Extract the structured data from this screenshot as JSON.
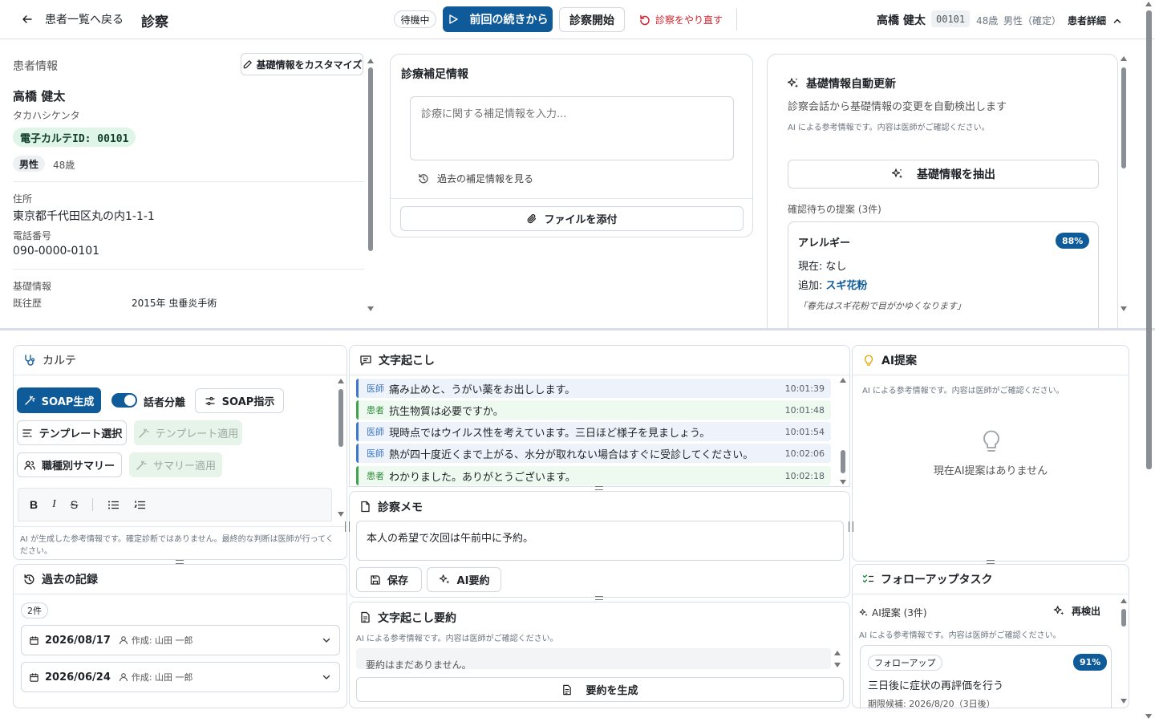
{
  "header": {
    "back_label": "患者一覧へ戻る",
    "page_title": "診察",
    "status_badge": "待機中",
    "resume_button": "前回の続きから",
    "start_button": "診察開始",
    "redo_button": "診察をやり直す",
    "patient_name": "高橋 健太",
    "patient_id": "00101",
    "patient_age": "48歳",
    "patient_sex": "男性（確定）",
    "details_label": "患者詳細"
  },
  "patient_info": {
    "section_title": "患者情報",
    "customize_button": "基礎情報をカスタマイズ",
    "name": "高橋 健太",
    "kana": "タカハシケンタ",
    "ehr_id": "電子カルテID: 00101",
    "sex_badge": "男性",
    "age": "48歳",
    "address_label": "住所",
    "address": "東京都千代田区丸の内1-1-1",
    "phone_label": "電話番号",
    "phone": "090-0000-0101",
    "basic_label": "基礎情報",
    "history_label": "既往歴",
    "history_value": "2015年 虫垂炎手術"
  },
  "supplement": {
    "title": "診療補足情報",
    "placeholder": "診療に関する補足情報を入力...",
    "past_link": "過去の補足情報を見る",
    "attach_button": "ファイルを添付"
  },
  "auto_update": {
    "title": "基礎情報自動更新",
    "description": "診察会話から基礎情報の変更を自動検出します",
    "note": "AI による参考情報です。内容は医師がご確認ください。",
    "extract_button": "基礎情報を抽出",
    "pending_label": "確認待ちの提案 (3件)",
    "proposal": {
      "category": "アレルギー",
      "confidence": "88%",
      "current_label": "現在:",
      "current_value": "なし",
      "add_label": "追加:",
      "add_value": "スギ花粉",
      "quote": "「春先はスギ花粉で目がかゆくなります」"
    }
  },
  "karte": {
    "title": "カルテ",
    "soap_generate": "SOAP生成",
    "speaker_toggle": "話者分離",
    "speaker_toggle_on": true,
    "soap_instruction": "SOAP指示",
    "template_select": "テンプレート選択",
    "template_apply": "テンプレート適用",
    "role_summary": "職種別サマリー",
    "summary_apply": "サマリー適用",
    "disclaimer": "AI が生成した参考情報です。確定診断ではありません。最終的な判断は医師が行ってください。"
  },
  "transcript": {
    "title": "文字起こし",
    "rows": [
      {
        "speaker": "医師",
        "role": "doc",
        "text": "痛み止めと、うがい薬をお出しします。",
        "time": "10:01:39"
      },
      {
        "speaker": "患者",
        "role": "pat",
        "text": "抗生物質は必要ですか。",
        "time": "10:01:48"
      },
      {
        "speaker": "医師",
        "role": "doc",
        "text": "現時点ではウイルス性を考えています。三日ほど様子を見ましょう。",
        "time": "10:01:54"
      },
      {
        "speaker": "医師",
        "role": "doc",
        "text": "熱が四十度近くまで上がる、水分が取れない場合はすぐに受診してください。",
        "time": "10:02:06"
      },
      {
        "speaker": "患者",
        "role": "pat",
        "text": "わかりました。ありがとうございます。",
        "time": "10:02:18"
      }
    ]
  },
  "ai_suggest": {
    "title": "AI提案",
    "note": "AI による参考情報です。内容は医師がご確認ください。",
    "empty": "現在AI提案はありません"
  },
  "memo": {
    "title": "診察メモ",
    "content": "本人の希望で次回は午前中に予約。",
    "save_button": "保存",
    "ai_summary_button": "AI要約"
  },
  "history": {
    "title": "過去の記録",
    "count": "2件",
    "records": [
      {
        "date": "2026/08/17",
        "author": "作成: 山田 一郎"
      },
      {
        "date": "2026/06/24",
        "author": "作成: 山田 一郎"
      }
    ]
  },
  "summary": {
    "title": "文字起こし要約",
    "note": "AI による参考情報です。内容は医師がご確認ください。",
    "empty": "要約はまだありません。",
    "generate_button": "要約を生成"
  },
  "followup": {
    "title": "フォローアップタスク",
    "ai_label": "AI提案 (3件)",
    "redetect": "再検出",
    "note": "AI による参考情報です。内容は医師がご確認ください。",
    "task": {
      "tag": "フォローアップ",
      "confidence": "91%",
      "text": "三日後に症状の再評価を行う",
      "due": "期限候補: 2026/8/20（3日後）"
    }
  },
  "colors": {
    "primary": "#0f5b9a",
    "ehr_badge_bg": "#dff5e7",
    "danger": "#d1242f",
    "doctor": "#3d78c8",
    "patient": "#3fa34d"
  }
}
